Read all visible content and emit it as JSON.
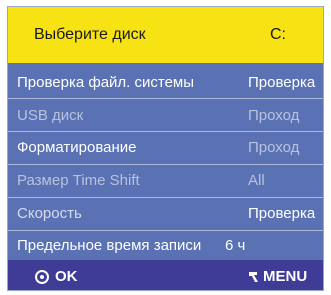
{
  "header": {
    "label": "Выберите диск",
    "value": "C:"
  },
  "rows": [
    {
      "label": "Проверка файл. системы",
      "value": "Проверка"
    },
    {
      "label": "USB диск",
      "value": "Проход"
    },
    {
      "label": "Форматирование",
      "value": "Проход"
    },
    {
      "label": "Размер Time Shift",
      "value": "All"
    },
    {
      "label": "Скорость",
      "value": "Проверка"
    },
    {
      "label": "Предельное время записи",
      "value": "6 ч"
    }
  ],
  "footer": {
    "ok_label": "OK",
    "menu_label": "MENU",
    "ok_icon": "ok-circle-icon",
    "menu_icon": "menu-arrow-icon"
  },
  "colors": {
    "header_bg": "#f7e214",
    "panel_bg": "#5a72b4",
    "footer_bg": "#3f3c97",
    "text_active": "#ffffff",
    "text_disabled": "#b9c2dd"
  }
}
